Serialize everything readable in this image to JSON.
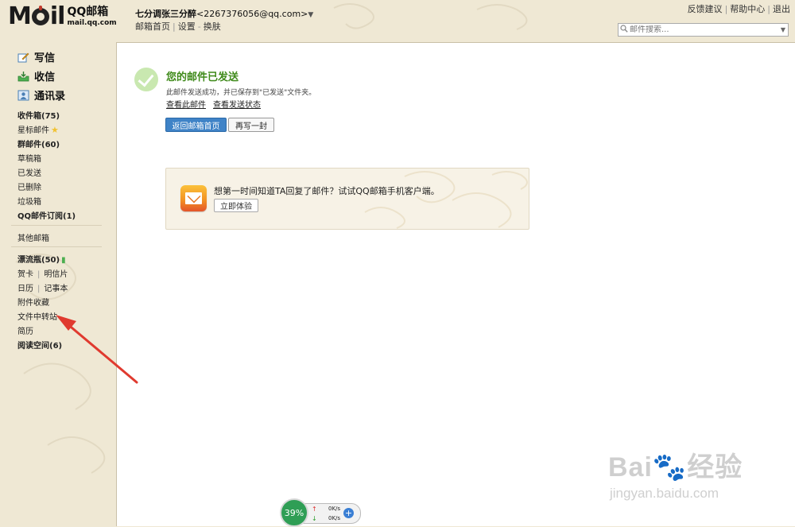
{
  "header": {
    "logo_mail": "M",
    "logo_mail_rest": "il",
    "logo_cn": "QQ邮箱",
    "logo_url": "mail.qq.com",
    "account_name": "七分调张三分醉",
    "account_email": "<2267376056@qq.com>",
    "account_arrow": "▼",
    "sublinks": [
      "邮箱首页",
      "设置",
      "换肤"
    ],
    "sublink_seps": [
      "|",
      "-"
    ],
    "toplinks": [
      "反馈建议",
      "帮助中心",
      "退出"
    ],
    "toplink_sep": "|",
    "search_placeholder": "邮件搜索..."
  },
  "sidebar": {
    "actions": [
      {
        "label": "写信",
        "icon": "pen-icon"
      },
      {
        "label": "收信",
        "icon": "inbox-icon"
      },
      {
        "label": "通讯录",
        "icon": "contacts-icon"
      }
    ],
    "items": {
      "inbox": "收件箱(75)",
      "starred": "星标邮件",
      "groups": "群邮件(60)",
      "drafts": "草稿箱",
      "sent": "已发送",
      "deleted": "已删除",
      "spam": "垃圾箱",
      "subscriptions": "QQ邮件订阅(1)",
      "other": "其他邮箱",
      "bottle": "漂流瓶(50)",
      "cards": "贺卡",
      "postcards": "明信片",
      "calendar": "日历",
      "notes": "记事本",
      "attachments": "附件收藏",
      "file_transfer": "文件中转站",
      "resume": "简历",
      "reading": "阅读空间(6)"
    },
    "pipe": "|"
  },
  "main": {
    "title": "您的邮件已发送",
    "description": "此邮件发送成功，并已保存到\"已发送\"文件夹。",
    "links": [
      "查看此邮件",
      "查看发送状态"
    ],
    "buttons": {
      "primary": "返回邮箱首页",
      "secondary": "再写一封"
    },
    "promo": {
      "text": "想第一时间知道TA回复了邮件？试试QQ邮箱手机客户端。",
      "button": "立即体验"
    }
  },
  "widget": {
    "percent": "39%",
    "up_arrow": "↑",
    "down_arrow": "↓",
    "up_speed": "0K/s",
    "down_speed": "0K/s",
    "plus": "+"
  },
  "watermark": {
    "main": "Bai🐾经验",
    "url": "jingyan.baidu.com"
  },
  "colors": {
    "background": "#efe8d4",
    "success_green": "#3f8a1a",
    "primary_button": "#3f83c7",
    "annotation_arrow": "#e03a2f"
  }
}
